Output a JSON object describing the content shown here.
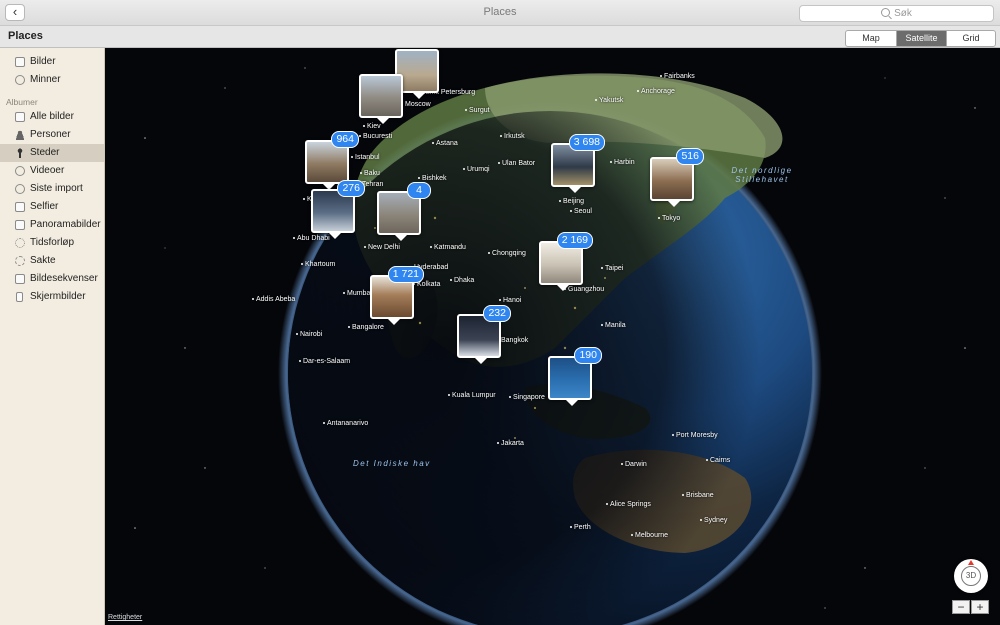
{
  "window": {
    "title": "Places",
    "back_label": "‹"
  },
  "search": {
    "placeholder": "Søk"
  },
  "toolbar": {
    "section_title": "Places",
    "segments": [
      "Map",
      "Satellite",
      "Grid"
    ],
    "active_segment": "Satellite"
  },
  "sidebar": {
    "items_top": [
      {
        "label": "Bilder",
        "icon": "photos-icon"
      },
      {
        "label": "Minner",
        "icon": "memories-icon"
      }
    ],
    "albums_header": "Albumer",
    "albums": [
      {
        "label": "Alle bilder",
        "icon": "all-photos-icon"
      },
      {
        "label": "Personer",
        "icon": "person-icon"
      },
      {
        "label": "Steder",
        "icon": "location-pin-icon",
        "selected": true
      },
      {
        "label": "Videoer",
        "icon": "video-icon"
      },
      {
        "label": "Siste import",
        "icon": "import-icon"
      },
      {
        "label": "Selfier",
        "icon": "camera-icon"
      },
      {
        "label": "Panoramabilder",
        "icon": "panorama-icon"
      },
      {
        "label": "Tidsforløp",
        "icon": "timelapse-icon"
      },
      {
        "label": "Sakte",
        "icon": "slowmo-icon"
      },
      {
        "label": "Bildesekvenser",
        "icon": "burst-icon"
      },
      {
        "label": "Skjermbilder",
        "icon": "screenshot-icon"
      }
    ]
  },
  "map": {
    "cities": [
      "Fairbanks",
      "Anchorage",
      "Yakutsk",
      "Sankt Petersburg",
      "Moscow",
      "Surgut",
      "Kiev",
      "Bucuresti",
      "Astana",
      "Irkutsk",
      "Istanbul",
      "Baku",
      "Tehran",
      "Urumqi",
      "Ulan Bator",
      "Harbin",
      "Kuwait",
      "Bishkek",
      "Beijing",
      "Seoul",
      "Tokyo",
      "Abu Dhabi",
      "New Delhi",
      "Katmandu",
      "Chongqing",
      "Khartoum",
      "Hyderabad",
      "Kolkata",
      "Dhaka",
      "Taipei",
      "Addis Abeba",
      "Mumbai",
      "Guangzhou",
      "Bangalore",
      "Hanoi",
      "Bangkok",
      "Nairobi",
      "Manila",
      "Dar-es-Salaam",
      "Kuala Lumpur",
      "Singapore",
      "Antananarivo",
      "Port Moresby",
      "Jakarta",
      "Darwin",
      "Cairns",
      "Brisbane",
      "Alice Springs",
      "Perth",
      "Sydney",
      "Melbourne"
    ],
    "seas": [
      "Det nordlige Stillehavet",
      "Det Indiske hav"
    ],
    "clusters": [
      "964",
      "276",
      "4",
      "1 721",
      "232",
      "3 698",
      "516",
      "2 169",
      "190"
    ],
    "compass_label": "3D",
    "zoom_out": "−",
    "zoom_in": "+",
    "legal": "Rettigheter"
  }
}
